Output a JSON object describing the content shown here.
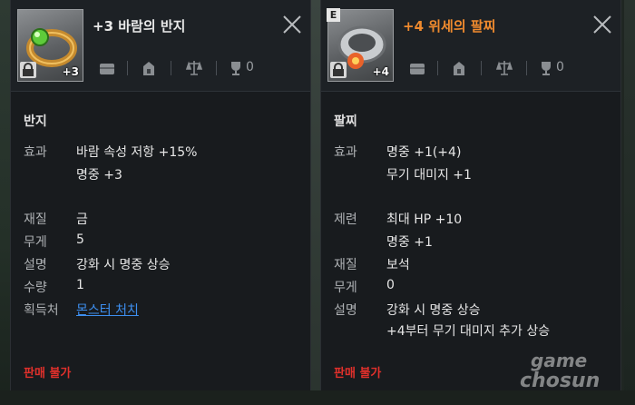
{
  "left": {
    "title": "+3 바람의 반지",
    "enhance_badge": "+3",
    "count": "0",
    "category": "반지",
    "rows": [
      {
        "label": "효과",
        "values": [
          "바람 속성 저항 +15%",
          "명중 +3"
        ]
      },
      {
        "label": "재질",
        "values": [
          "금"
        ]
      },
      {
        "label": "무게",
        "values": [
          "5"
        ]
      },
      {
        "label": "설명",
        "values": [
          "강화 시 명중 상승"
        ]
      },
      {
        "label": "수량",
        "values": [
          "1"
        ]
      },
      {
        "label": "획득처",
        "values": [
          "몬스터 처치"
        ]
      }
    ],
    "footer": "판매 불가"
  },
  "right": {
    "grade_badge": "E",
    "title": "+4 위세의 팔찌",
    "enhance_badge": "+4",
    "count": "0",
    "category": "팔찌",
    "rows": [
      {
        "label": "효과",
        "values": [
          "명중 +1(+4)",
          "무기 대미지 +1"
        ]
      },
      {
        "label": "제련",
        "values": [
          "최대 HP +10",
          "명중 +1"
        ]
      },
      {
        "label": "재질",
        "values": [
          "보석"
        ]
      },
      {
        "label": "무게",
        "values": [
          "0"
        ]
      },
      {
        "label": "설명",
        "values": [
          "강화 시 명중 상승",
          "+4부터 무기 대미지 추가 상승"
        ]
      }
    ],
    "footer": "판매 불가"
  },
  "watermark": {
    "line1": "game",
    "line2": "chosun"
  },
  "colors": {
    "panel_bg": "#181b1e",
    "title_orange": "#ef8a2e",
    "link_blue": "#3d8ff0",
    "no_sale_red": "#e0302b"
  }
}
